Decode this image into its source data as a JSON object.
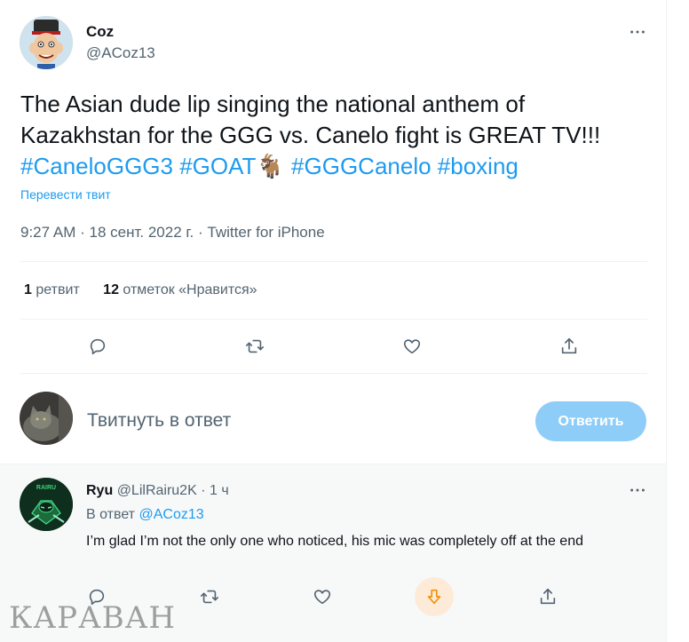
{
  "tweet": {
    "author_name": "Coz",
    "author_handle": "@ACoz13",
    "text_plain": "The Asian dude lip singing the national anthem of Kazakhstan for the GGG vs. Canelo fight is GREAT TV!!! ",
    "hashtags": [
      "#CaneloGGG3",
      "#GOAT🐐",
      "#GGGCanelo",
      "#boxing"
    ],
    "translate_label": "Перевести твит",
    "time": "9:27 AM",
    "date": "18 сент. 2022 г.",
    "source": "Twitter for iPhone",
    "sep": "·",
    "retweet_count": "1",
    "retweet_label": "ретвит",
    "like_count": "12",
    "like_label": "отметок «Нравится»",
    "more_icon": "more-horizontal-icon"
  },
  "reply_box": {
    "placeholder": "Твитнуть в ответ",
    "button_label": "Ответить"
  },
  "reply": {
    "author_name": "Ryu",
    "author_handle": "@LilRairu2K",
    "time": "1 ч",
    "sep": "·",
    "replying_to_label": "В ответ",
    "replying_to_handle": "@ACoz13",
    "text": "I’m glad I’m not the only one who noticed, his mic was completely off at the end",
    "avatar_text": "RAIRU"
  },
  "watermark": "КАРАВАН",
  "colors": {
    "accent": "#1d9bf0",
    "button_disabled": "#8ecdf8",
    "muted": "#536471",
    "reply_bg": "#f7f9f9",
    "downvote": "#f4900c"
  }
}
